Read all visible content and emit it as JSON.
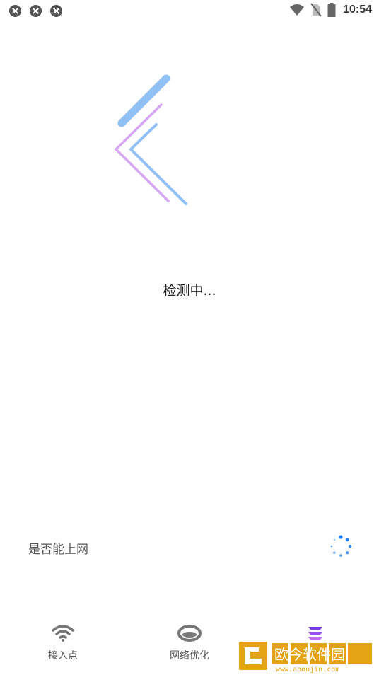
{
  "status_bar": {
    "time": "10:54"
  },
  "main": {
    "status_text": "检测中..."
  },
  "check": {
    "label": "是否能上网"
  },
  "bottom_nav": {
    "items": [
      {
        "label": "接入点",
        "icon": "wifi-icon"
      },
      {
        "label": "网络优化",
        "icon": "network-ring-icon"
      },
      {
        "label": "",
        "icon": "layers-icon"
      }
    ]
  },
  "watermark": {
    "text": "欧今软件园",
    "url": "www.apoujin.com"
  },
  "colors": {
    "logo_blue": "#90c0f6",
    "logo_purple": "#d5a6f3",
    "spinner_blue": "#1e7bf0",
    "watermark_gold": "#e2a414"
  }
}
